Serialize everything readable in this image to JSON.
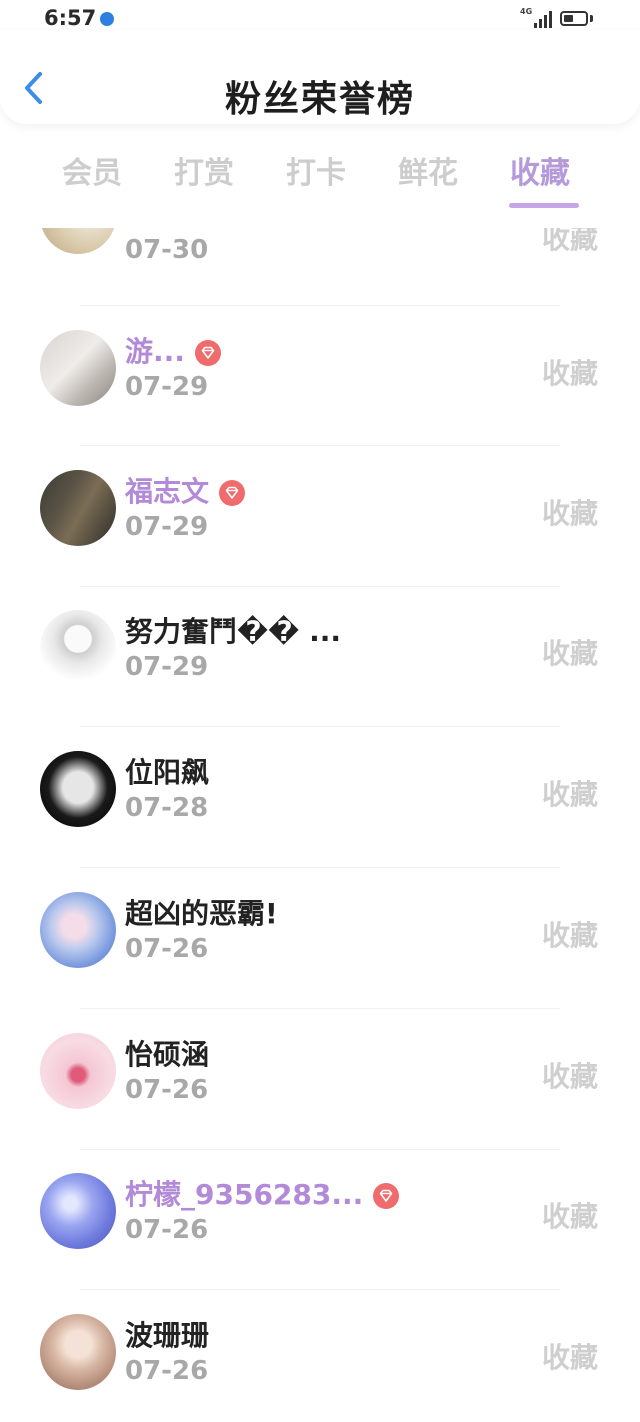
{
  "status_bar": {
    "time": "6:57",
    "network": "4G",
    "battery_level": 0.45
  },
  "header": {
    "title": "粉丝荣誉榜",
    "back_icon": "chevron-left-icon"
  },
  "tabs": [
    {
      "label": "会员",
      "active": false
    },
    {
      "label": "打赏",
      "active": false
    },
    {
      "label": "打卡",
      "active": false
    },
    {
      "label": "鲜花",
      "active": false
    },
    {
      "label": "收藏",
      "active": true
    }
  ],
  "colors": {
    "accent": "#b59ad9",
    "vip_name": "#b28ad8",
    "diamond_badge": "#f06b6b",
    "muted": "#a8a8a8"
  },
  "fans": [
    {
      "name": "",
      "date": "07-30",
      "action": "收藏",
      "vip": false
    },
    {
      "name": "游...",
      "date": "07-29",
      "action": "收藏",
      "vip": true
    },
    {
      "name": "福志文",
      "date": "07-29",
      "action": "收藏",
      "vip": true
    },
    {
      "name": "努力奮鬥�� ...",
      "date": "07-29",
      "action": "收藏",
      "vip": false
    },
    {
      "name": "位阳飙",
      "date": "07-28",
      "action": "收藏",
      "vip": false
    },
    {
      "name": "超凶的恶霸!",
      "date": "07-26",
      "action": "收藏",
      "vip": false
    },
    {
      "name": "怡硕涵",
      "date": "07-26",
      "action": "收藏",
      "vip": false
    },
    {
      "name": "柠檬_9356283...",
      "date": "07-26",
      "action": "收藏",
      "vip": true
    },
    {
      "name": "波珊珊",
      "date": "07-26",
      "action": "收藏",
      "vip": false
    }
  ]
}
